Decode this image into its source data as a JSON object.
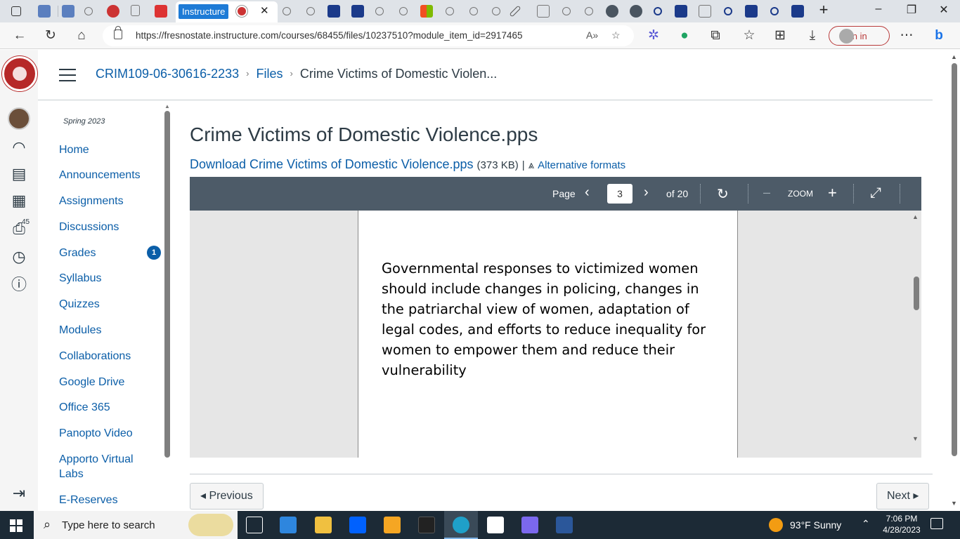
{
  "browser": {
    "active_tab_label": "Instructure",
    "url": "https://fresnostate.instructure.com/courses/68455/files/10237510?module_item_id=2917465",
    "sign_in_label": "Sign in"
  },
  "globalnav": {
    "inbox_count": "45"
  },
  "breadcrumb": {
    "course": "CRIM109-06-30616-2233",
    "files": "Files",
    "current": "Crime Victims of Domestic Violen..."
  },
  "coursenav": {
    "term": "Spring 2023",
    "items": [
      {
        "label": "Home"
      },
      {
        "label": "Announcements"
      },
      {
        "label": "Assignments"
      },
      {
        "label": "Discussions"
      },
      {
        "label": "Grades",
        "badge": "1"
      },
      {
        "label": "Syllabus"
      },
      {
        "label": "Quizzes"
      },
      {
        "label": "Modules"
      },
      {
        "label": "Collaborations"
      },
      {
        "label": "Google Drive"
      },
      {
        "label": "Office 365"
      },
      {
        "label": "Panopto Video"
      },
      {
        "label": "Apporto Virtual Labs"
      },
      {
        "label": "E-Reserves"
      }
    ]
  },
  "file": {
    "title": "Crime Victims of Domestic Violence.pps",
    "download_label": "Download Crime Victims of Domestic Violence.pps",
    "size": "(373 KB)",
    "separator": "|",
    "alt_formats": "Alternative formats"
  },
  "viewer": {
    "page_label": "Page",
    "page_value": "3",
    "of_label": "of 20",
    "zoom_label": "ZOOM",
    "slide_text": "Governmental responses to victimized women should include changes in policing, changes in the patriarchal view of women, adaptation of legal codes, and efforts to reduce inequality for women to empower them and reduce their vulnerability"
  },
  "footer": {
    "previous": "◂ Previous",
    "next": "Next ▸"
  },
  "taskbar": {
    "search_placeholder": "Type here to search",
    "weather": "93°F  Sunny",
    "time": "7:06 PM",
    "date": "4/28/2023"
  },
  "colors": {
    "canvas_link": "#0b5ea8",
    "canvas_text": "#2d3b45",
    "viewer_toolbar": "#4d5b68",
    "taskbar": "#1c2a36"
  }
}
